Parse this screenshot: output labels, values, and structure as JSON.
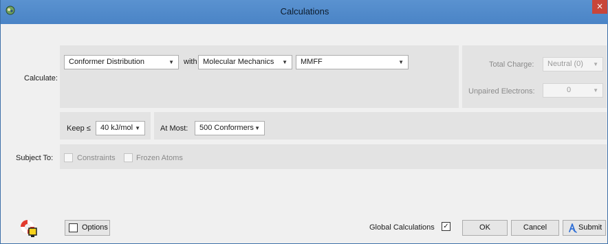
{
  "window": {
    "title": "Calculations",
    "close_glyph": "×"
  },
  "calculate": {
    "label": "Calculate:",
    "task_value": "Conformer Distribution",
    "with_label": "with",
    "method_value": "Molecular Mechanics",
    "forcefield_value": "MMFF"
  },
  "charge": {
    "total_charge_label": "Total Charge:",
    "total_charge_value": "Neutral (0)",
    "unpaired_label": "Unpaired Electrons:",
    "unpaired_value": "0"
  },
  "keep": {
    "keep_label": "Keep ≤",
    "keep_value": "40 kJ/mol",
    "atmost_label": "At Most:",
    "atmost_value": "500 Conformers"
  },
  "subject_to": {
    "label": "Subject To:",
    "constraints_label": "Constraints",
    "frozen_label": "Frozen Atoms"
  },
  "footer": {
    "options_label": "Options",
    "global_label": "Global Calculations",
    "global_check": "✓",
    "ok_label": "OK",
    "cancel_label": "Cancel",
    "submit_label": "Submit"
  },
  "icons": {
    "app": "spartan-app-icon",
    "help": "lifebuoy-help-icon",
    "submit": "submit-icon",
    "dropdown": "chevron-down-icon"
  },
  "colors": {
    "titlebar": "#4a84c6",
    "panel": "#e3e3e3",
    "close": "#c8453a",
    "window_bg": "#f0f0f0"
  }
}
